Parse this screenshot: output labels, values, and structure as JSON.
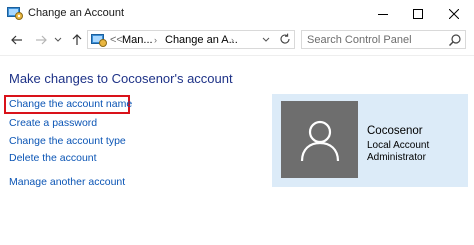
{
  "window": {
    "title": "Change an Account",
    "icons": {
      "app": "control-panel-icon",
      "minimize": "minimize-icon",
      "maximize": "maximize-icon",
      "close": "close-icon"
    }
  },
  "nav": {
    "icons": {
      "back": "back-arrow-icon",
      "forward": "forward-arrow-icon",
      "history": "chevron-down-icon",
      "up": "up-arrow-icon",
      "refresh": "refresh-icon",
      "search": "search-icon"
    },
    "address": {
      "overflow": "<<",
      "crumbs": [
        "Man...",
        "Change an A..."
      ]
    },
    "search": {
      "placeholder": "Search Control Panel",
      "value": ""
    }
  },
  "main": {
    "heading": "Make changes to Cocosenor's account",
    "tasks": [
      {
        "label": "Change the account name",
        "highlighted": true
      },
      {
        "label": "Create a password"
      },
      {
        "label": "Change the account type"
      },
      {
        "label": "Delete the account"
      },
      {
        "label": "Manage another account"
      }
    ],
    "highlight_color": "#d9121a"
  },
  "account": {
    "name": "Cocosenor",
    "type": "Local Account",
    "role": "Administrator",
    "avatar_icon": "user-silhouette-icon",
    "panel_color": "#dcebf8",
    "avatar_color": "#6e6e6e"
  },
  "colors": {
    "link": "#0b55b5",
    "heading": "#1e3287"
  }
}
